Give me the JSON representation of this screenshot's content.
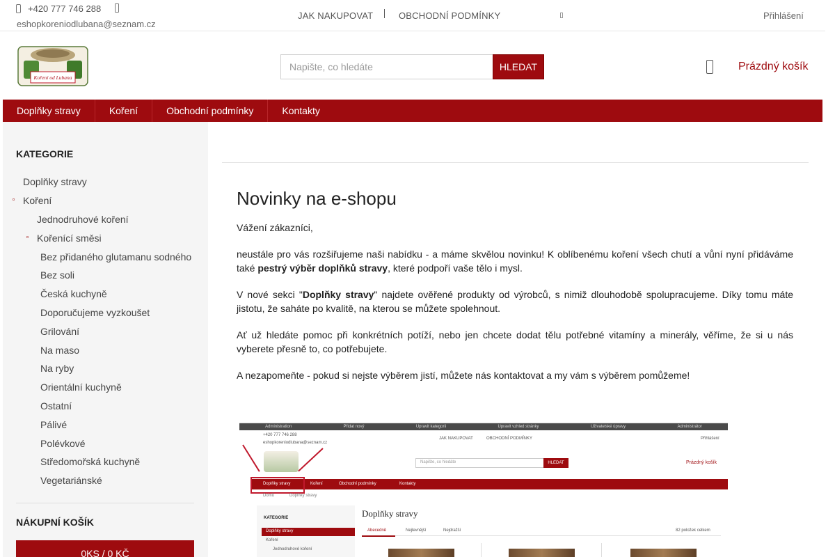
{
  "topbar": {
    "phone": "+420 777 746 288",
    "email": "eshopkoreniodlubana@seznam.cz",
    "links": [
      "JAK NAKUPOVAT",
      "OBCHODNÍ PODMÍNKY"
    ],
    "login": "Přihlášení"
  },
  "header": {
    "logo_text": "Koření od Lubana",
    "search_placeholder": "Napište, co hledáte",
    "search_button": "HLEDAT",
    "cart_label": "Prázdný košík"
  },
  "nav": [
    "Doplňky stravy",
    "Koření",
    "Obchodní podmínky",
    "Kontakty"
  ],
  "sidebar": {
    "categories_heading": "KATEGORIE",
    "categories": [
      {
        "label": "Doplňky stravy",
        "level": 0
      },
      {
        "label": "Koření",
        "level": 0
      },
      {
        "label": "Jednodruhové koření",
        "level": 1
      },
      {
        "label": "Kořenící směsi",
        "level": 1
      },
      {
        "label": "Bez přidaného glutamanu sodného",
        "level": 2
      },
      {
        "label": "Bez soli",
        "level": 2
      },
      {
        "label": "Česká kuchyně",
        "level": 2
      },
      {
        "label": "Doporučujeme vyzkoušet",
        "level": 2
      },
      {
        "label": "Grilování",
        "level": 2
      },
      {
        "label": "Na maso",
        "level": 2
      },
      {
        "label": "Na ryby",
        "level": 2
      },
      {
        "label": "Orientální kuchyně",
        "level": 2
      },
      {
        "label": "Ostatní",
        "level": 2
      },
      {
        "label": "Pálivé",
        "level": 2
      },
      {
        "label": "Polévkové",
        "level": 2
      },
      {
        "label": "Středomořská kuchyně",
        "level": 2
      },
      {
        "label": "Vegetariánské",
        "level": 2
      }
    ],
    "cart_heading": "NÁKUPNÍ KOŠÍK",
    "cart_summary": "0KS / 0 KČ"
  },
  "content": {
    "title": "Novinky na e-shopu",
    "greeting": "Vážení zákazníci,",
    "p1_before": "neustále pro vás rozšiřujeme naši nabídku - a máme skvělou novinku! K oblíbenému koření všech chutí a vůní nyní přidáváme také ",
    "p1_bold": "pestrý výběr doplňků stravy",
    "p1_after": ", které podpoří vaše tělo i mysl.",
    "p2_before": "V nové sekci \"",
    "p2_bold": "Doplňky stravy",
    "p2_after": "\" najdete ověřené produkty od výrobců, s nimiž dlouhodobě spolupracujeme. Díky tomu máte jistotu, že saháte po kvalitě, na kterou se můžete spolehnout.",
    "p3": "Ať už hledáte pomoc při konkrétních potíží, nebo jen chcete dodat tělu potřebné vitamíny a minerály, věříme, že si u nás vyberete přesně to, co potřebujete.",
    "p4": "A nezapomeňte - pokud si nejste výběrem jistí, můžete nás kontaktovat a my vám s výběrem pomůžeme!"
  },
  "embedded_screenshot": {
    "admin_items": [
      "Administration",
      "Přidat nový",
      "Upravit kategorii",
      "Upravit vzhled stránky",
      "Uživatelské úpravy",
      "Administrátor"
    ],
    "phone": "+420 777 746 288",
    "email": "eshopkoreniodlubana@seznam.cz",
    "links": [
      "JAK NAKUPOVAT",
      "OBCHODNÍ PODMÍNKY"
    ],
    "login": "Přihlášení",
    "search_placeholder": "Napište, co hledáte",
    "search_button": "HLEDAT",
    "cart_label": "Prázdný košík",
    "nav": [
      "Doplňky stravy",
      "Koření",
      "Obchodní podmínky",
      "Kontakty"
    ],
    "breadcrumb": [
      "Domů",
      "Doplňky stravy"
    ],
    "side_heading": "KATEGORIE",
    "side_items": [
      "Doplňky stravy",
      "Koření",
      "Jednodruhové koření"
    ],
    "title": "Doplňky stravy",
    "tabs": [
      "Abecedně",
      "Nejlevnější",
      "Nejdražší"
    ],
    "count": "82 položek celkem"
  },
  "colors": {
    "brand_red": "#9e0b0f",
    "sidebar_bg": "#f5f5f5"
  }
}
